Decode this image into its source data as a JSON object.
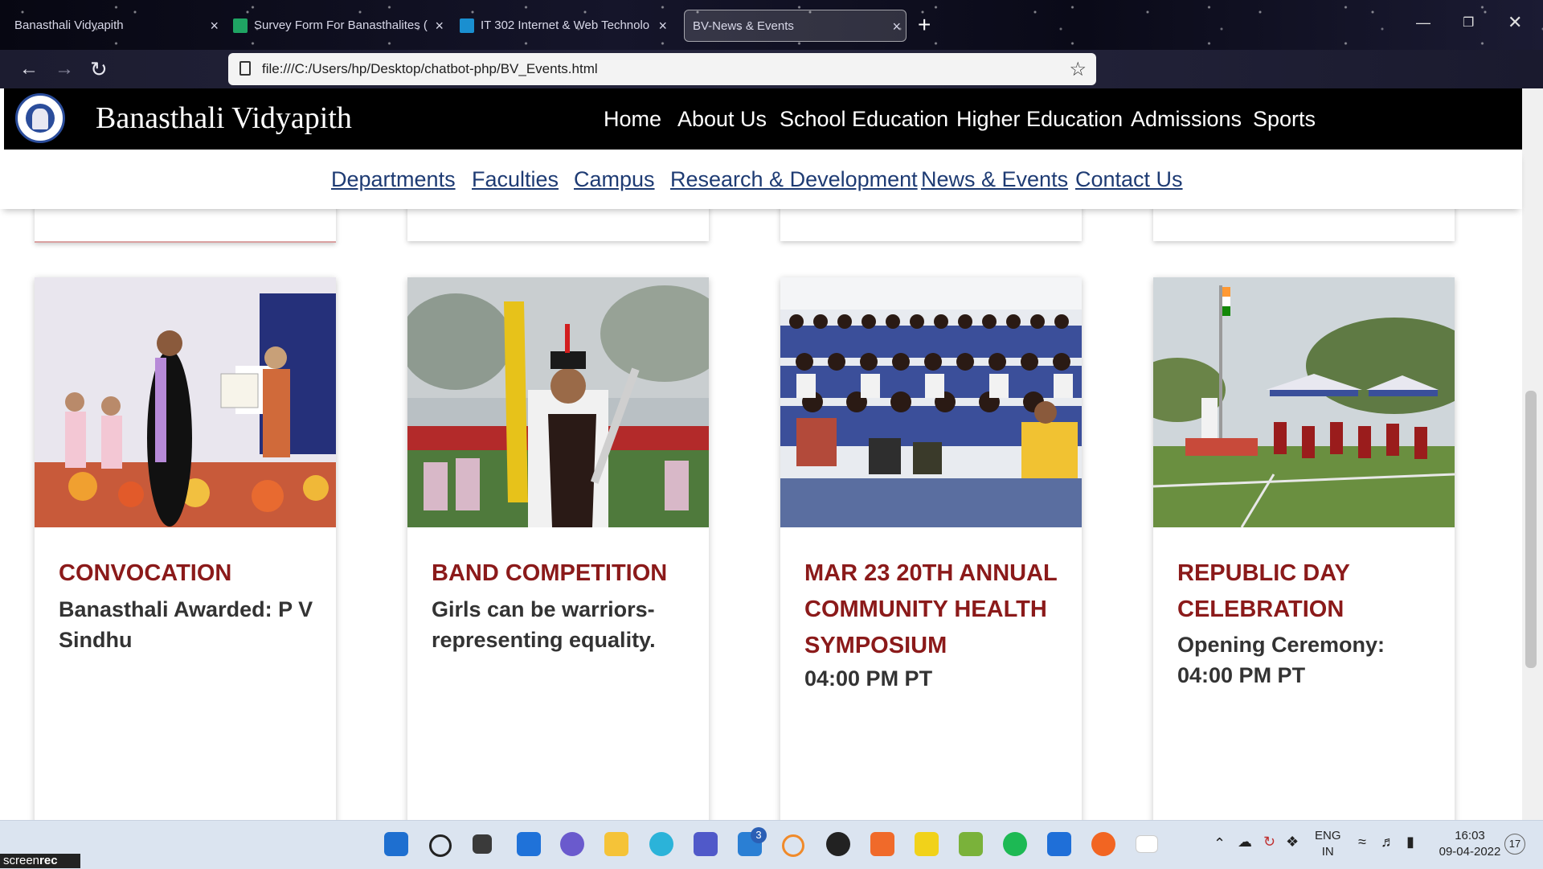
{
  "browser": {
    "tabs": [
      {
        "title": "Banasthali Vidyapith",
        "active": false
      },
      {
        "title": "Survey Form For Banasthalites (",
        "active": false
      },
      {
        "title": "IT 302 Internet & Web Technolo",
        "active": false
      },
      {
        "title": "BV-News & Events",
        "active": true
      }
    ],
    "url": "file:///C:/Users/hp/Desktop/chatbot-php/BV_Events.html",
    "new_tab": "+",
    "close_glyph": "×"
  },
  "site": {
    "title": "Banasthali Vidyapith",
    "main_nav": [
      "Home",
      "About Us",
      "School Education",
      "Higher Education",
      "Admissions",
      "Sports"
    ],
    "sub_nav": [
      "Departments",
      "Faculties",
      "Campus",
      "Research & Development",
      "News & Events",
      "Contact Us"
    ]
  },
  "cards": [
    {
      "category": "CONVOCATION",
      "description": "Banasthali Awarded: P V Sindhu"
    },
    {
      "category": "BAND COMPETITION",
      "description": "Girls can be warriors- representing equality."
    },
    {
      "category": "Mar 23 20th Annual Community Health Symposium",
      "description": "04:00 PM PT"
    },
    {
      "category": "REPUBLIC DAY CELEBRATION",
      "description": "Opening Ceremony: 04:00 PM PT"
    }
  ],
  "taskbar": {
    "mail_badge": "3",
    "language": "ENG",
    "region": "IN",
    "time": "16:03",
    "date": "09-04-2022",
    "notifications": "17",
    "screenrec_a": "screen",
    "screenrec_b": "rec"
  },
  "colors": {
    "accent": "#8b1a1a",
    "link": "#1e3b73",
    "header_bg": "#000000"
  }
}
